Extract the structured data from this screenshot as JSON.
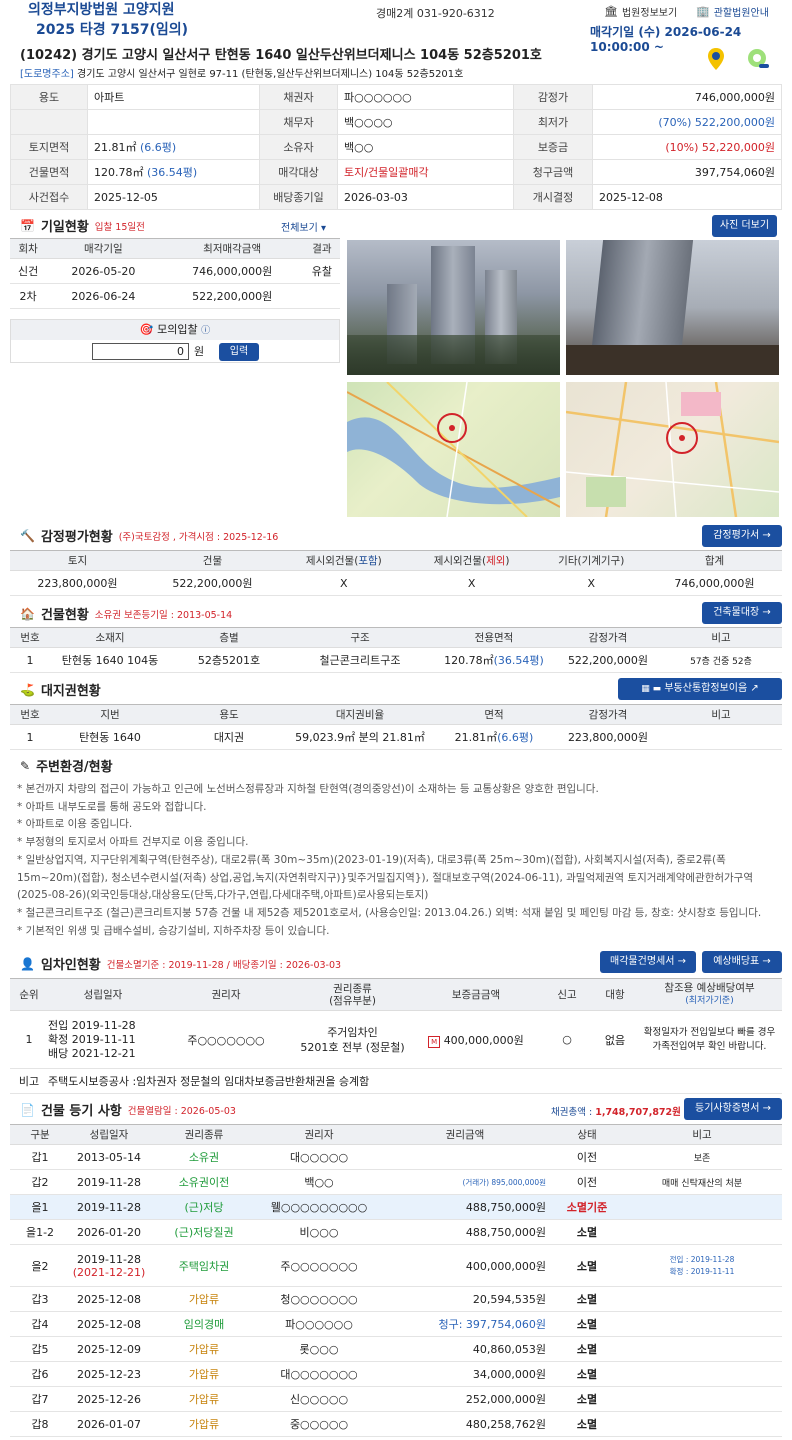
{
  "header": {
    "court": "의정부지방법원 고양지원",
    "case_no": "2025 타경 7157(임의)",
    "dept": "경매2계 031-920-6312",
    "court_info": "법원정보보기",
    "office_info": "관할법원안내",
    "sale_date": "매각기일 (수) 2026-06-24 10:00:00 ~"
  },
  "address": {
    "main": "(10242) 경기도 고양시 일산서구 탄현동 1640 일산두산위브더제니스 104동 52층5201호",
    "road_tag": "[도로명주소]",
    "road": "경기도 고양시 일산서구 일현로 97-11 (탄현동,일산두산위브더제니스) 104동 52층5201호"
  },
  "summary": {
    "use_l": "용도",
    "use": "아파트",
    "creditor_l": "채권자",
    "creditor": "파○○○○○○",
    "appraisal_l": "감정가",
    "appraisal": "746,000,000원",
    "debtor_l": "채무자",
    "debtor": "백○○○○",
    "min_l": "최저가",
    "min": "(70%) 522,200,000원",
    "land_l": "토지면적",
    "land_a": "21.81㎡",
    "land_b": "(6.6평)",
    "owner_l": "소유자",
    "owner": "백○○",
    "deposit_l": "보증금",
    "deposit": "(10%) 52,220,000원",
    "bldg_l": "건물면적",
    "bldg_a": "120.78㎡",
    "bldg_b": "(36.54평)",
    "target_l": "매각대상",
    "target": "토지/건물일괄매각",
    "claim_l": "청구금액",
    "claim": "397,754,060원",
    "recv_l": "사건접수",
    "recv": "2025-12-05",
    "divend_l": "배당종기일",
    "divend": "2026-03-03",
    "start_l": "개시결정",
    "start": "2025-12-08"
  },
  "schedule": {
    "title": "기일현황",
    "sub": "입찰 15일전",
    "view_all": "전체보기",
    "photo_more": "사진 더보기",
    "cols": [
      "회차",
      "매각기일",
      "최저매각금액",
      "결과"
    ],
    "rows": [
      [
        "신건",
        "2026-05-20",
        "746,000,000원",
        "유찰"
      ],
      [
        "2차",
        "2026-06-24",
        "522,200,000원",
        ""
      ]
    ]
  },
  "mock": {
    "title": "모의입찰",
    "value": "0",
    "unit": "원",
    "btn": "입력"
  },
  "appraisal": {
    "title": "감정평가현황",
    "sub": "(주)국토감정 , 가격시점 : 2025-12-16",
    "btn": "감정평가서",
    "cols": [
      "토지",
      "건물",
      "제시외건물(",
      "포함",
      ")",
      "제시외건물(",
      "제외",
      ")",
      "기타(기계기구)",
      "합계"
    ],
    "row": [
      "223,800,000원",
      "522,200,000원",
      "X",
      "X",
      "X",
      "746,000,000원"
    ]
  },
  "building": {
    "title": "건물현황",
    "sub": "소유권 보존등기일 : 2013-05-14",
    "btn": "건축물대장",
    "cols": [
      "번호",
      "소재지",
      "층별",
      "구조",
      "전용면적",
      "감정가격",
      "비고"
    ],
    "row": [
      "1",
      "탄현동 1640 104동",
      "52층5201호",
      "철근콘크리트구조",
      "120.78㎡",
      "(36.54평)",
      "522,200,000원",
      "57층 건중 52층"
    ]
  },
  "land": {
    "title": "대지권현황",
    "btn": "부동산통합정보이음",
    "cols": [
      "번호",
      "지번",
      "용도",
      "대지권비율",
      "면적",
      "감정가격",
      "비고"
    ],
    "row": [
      "1",
      "탄현동 1640",
      "대지권",
      "59,023.9㎡ 분의 21.81㎡",
      "21.81㎡",
      "(6.6평)",
      "223,800,000원",
      ""
    ]
  },
  "env": {
    "title": "주변환경/현황",
    "lines": [
      "* 본건까지 차량의 접근이 가능하고 인근에 노선버스정류장과 지하철 탄현역(경의중앙선)이 소재하는 등 교통상황은 양호한 편입니다.",
      "* 아파트 내부도로를 통해 공도와 접합니다.",
      "* 아파트로 이용 중입니다.",
      "* 부정형의 토지로서 아파트 건부지로 이용 중입니다.",
      "* 일반상업지역, 지구단위계획구역(탄현주상), 대로2류(폭 30m~35m)(2023-01-19)(저촉), 대로3류(폭 25m~30m)(접합), 사회복지시설(저촉), 중로2류(폭 15m~20m)(접합), 청소년수련시설(저촉) 상업,공업,녹지(자연취락지구)}및주거밀집지역}), 절대보호구역(2024-06-11), 과밀억제권역 토지거래계약에관한허가구역(2025-08-26)(외국인등대상,대상용도(단독,다가구,연립,다세대주택,아파트)로사용되는토지)",
      "* 철근콘크리트구조 (철근)콘크리트지붕 57층 건물 내 제52층 제5201호로서, (사용승인일: 2013.04.26.) 외벽: 석재 붙임 및 페인팅 마감 등, 창호: 샷시창호 등입니다.",
      "* 기본적인 위생 및 급배수설비, 승강기설비, 지하주차장 등이 있습니다."
    ]
  },
  "tenant": {
    "title": "임차인현황",
    "sub": "건물소멸기준 : 2019-11-28 / 배당종기일 : 2026-03-03",
    "btn1": "매각물건명세서",
    "btn2": "예상배당표",
    "cols": [
      "순위",
      "성립일자",
      "권리자",
      "권리종류",
      "(점유부분)",
      "보증금금액",
      "신고",
      "대항",
      "참조용 예상배당여부",
      "(최저가기준)"
    ],
    "row": {
      "rank": "1",
      "d1": "전입 2019-11-28",
      "d2": "확정 2019-11-11",
      "d3": "배당 2021-12-21",
      "holder": "주○○○○○○○",
      "kind1": "주거임차인",
      "kind2": "5201호 전부 (정문철)",
      "amount": "400,000,000원",
      "report": "○",
      "oppose": "없음",
      "ref1": "확정일자가 전입일보다 빠를 경우",
      "ref2": "가족전입여부 확인 바랍니다."
    },
    "note_l": "비고",
    "note": "주택도시보증공사 :임차권자 정문철의 임대차보증금반환채권을 승계함"
  },
  "registry": {
    "title": "건물 등기 사항",
    "sub": "건물열람일 : 2026-05-03",
    "total_l": "채권총액 :",
    "total": "1,748,707,872원",
    "btn": "등기사항증명서",
    "cols": [
      "구분",
      "성립일자",
      "권리종류",
      "권리자",
      "권리금액",
      "상태",
      "비고"
    ],
    "rows": [
      {
        "k": "갑1",
        "d": "2013-05-14",
        "t": "소유권",
        "h": "대○○○○○",
        "a": "",
        "s": "이전",
        "n": "보존"
      },
      {
        "k": "갑2",
        "d": "2019-11-28",
        "t": "소유권이전",
        "h": "백○○",
        "a": "(거래가) 895,000,000원",
        "s": "이전",
        "n": "매매 신탁재산의 처분"
      },
      {
        "k": "을1",
        "d": "2019-11-28",
        "t": "(근)저당",
        "h": "웰○○○○○○○○○",
        "a": "488,750,000원",
        "s": "소멸기준",
        "n": ""
      },
      {
        "k": "을1-2",
        "d": "2026-01-20",
        "t": "(근)저당질권",
        "h": "비○○○",
        "a": "488,750,000원",
        "s": "소멸",
        "n": ""
      },
      {
        "k": "을2",
        "d": "2019-11-28",
        "d2": "(2021-12-21)",
        "t": "주택임차권",
        "h": "주○○○○○○○",
        "a": "400,000,000원",
        "s": "소멸",
        "n": "전입 : 2019-11-28",
        "n2": "확정 : 2019-11-11"
      },
      {
        "k": "갑3",
        "d": "2025-12-08",
        "t": "가압류",
        "h": "청○○○○○○○",
        "a": "20,594,535원",
        "s": "소멸",
        "n": ""
      },
      {
        "k": "갑4",
        "d": "2025-12-08",
        "t": "임의경매",
        "h": "파○○○○○○",
        "a": "청구: 397,754,060원",
        "s": "소멸",
        "n": ""
      },
      {
        "k": "갑5",
        "d": "2025-12-09",
        "t": "가압류",
        "h": "롯○○○",
        "a": "40,860,053원",
        "s": "소멸",
        "n": ""
      },
      {
        "k": "갑6",
        "d": "2025-12-23",
        "t": "가압류",
        "h": "대○○○○○○○",
        "a": "34,000,000원",
        "s": "소멸",
        "n": ""
      },
      {
        "k": "갑7",
        "d": "2025-12-26",
        "t": "가압류",
        "h": "신○○○○○",
        "a": "252,000,000원",
        "s": "소멸",
        "n": ""
      },
      {
        "k": "갑8",
        "d": "2026-01-07",
        "t": "가압류",
        "h": "중○○○○○",
        "a": "480,258,762원",
        "s": "소멸",
        "n": ""
      }
    ]
  }
}
